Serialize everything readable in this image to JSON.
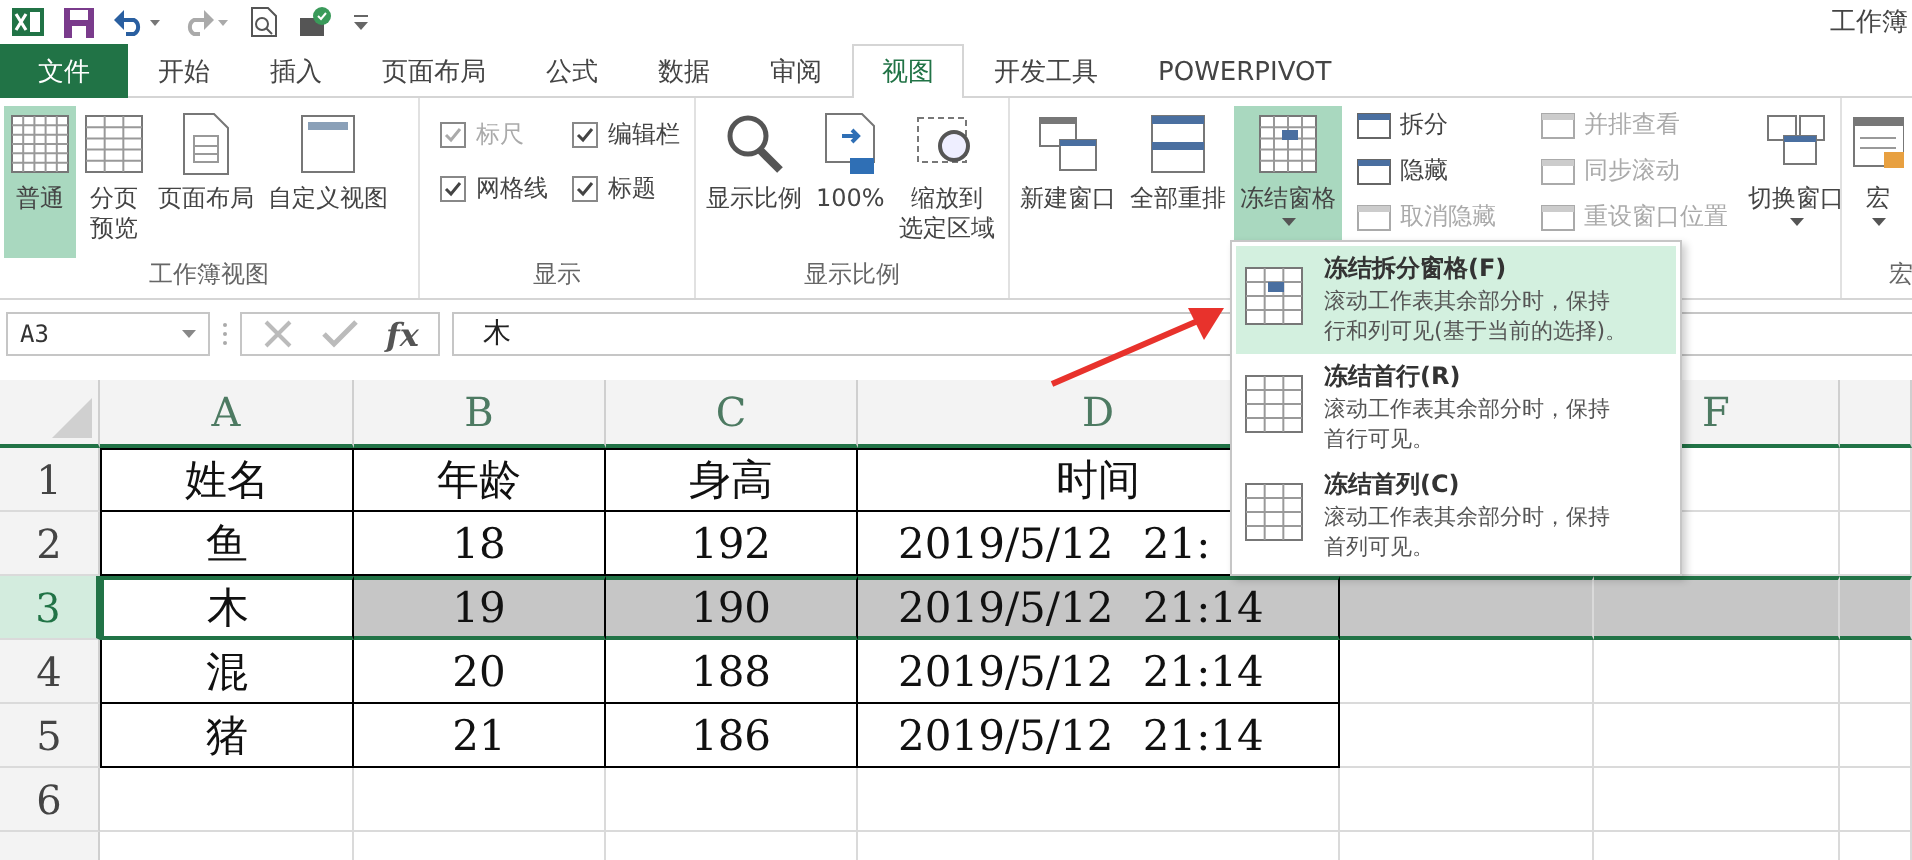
{
  "window": {
    "title": "工作簿"
  },
  "tabs": [
    {
      "label": "文件",
      "kind": "file",
      "selected": false
    },
    {
      "label": "开始",
      "kind": "tab",
      "selected": false
    },
    {
      "label": "插入",
      "kind": "tab",
      "selected": false
    },
    {
      "label": "页面布局",
      "kind": "tab",
      "selected": false
    },
    {
      "label": "公式",
      "kind": "tab",
      "selected": false
    },
    {
      "label": "数据",
      "kind": "tab",
      "selected": false
    },
    {
      "label": "审阅",
      "kind": "tab",
      "selected": false
    },
    {
      "label": "视图",
      "kind": "tab",
      "selected": true
    },
    {
      "label": "开发工具",
      "kind": "tab",
      "selected": false
    },
    {
      "label": "POWERPIVOT",
      "kind": "tab",
      "selected": false
    }
  ],
  "ribbon": {
    "groups": [
      {
        "label": "工作簿视图",
        "items": [
          {
            "kind": "large",
            "label_lines": [
              "普通"
            ],
            "selected": true,
            "dropdown": false
          },
          {
            "kind": "large",
            "label_lines": [
              "分页",
              "预览"
            ],
            "selected": false,
            "dropdown": false
          },
          {
            "kind": "large",
            "label_lines": [
              "页面布局"
            ],
            "selected": false,
            "dropdown": false
          },
          {
            "kind": "large",
            "label_lines": [
              "自定义视图"
            ],
            "selected": false,
            "dropdown": false
          }
        ]
      },
      {
        "label": "显示",
        "items": [
          {
            "kind": "checks",
            "checks": [
              {
                "label": "标尺",
                "checked": true,
                "disabled": true
              },
              {
                "label": "编辑栏",
                "checked": true,
                "disabled": false
              },
              {
                "label": "网格线",
                "checked": true,
                "disabled": false
              },
              {
                "label": "标题",
                "checked": true,
                "disabled": false
              }
            ]
          }
        ]
      },
      {
        "label": "显示比例",
        "items": [
          {
            "kind": "large",
            "label_lines": [
              "显示比例"
            ],
            "selected": false,
            "dropdown": false
          },
          {
            "kind": "large",
            "label_lines": [
              "100%"
            ],
            "selected": false,
            "dropdown": false
          },
          {
            "kind": "large",
            "label_lines": [
              "缩放到",
              "选定区域"
            ],
            "selected": false,
            "dropdown": false
          }
        ]
      },
      {
        "items": [
          {
            "kind": "large",
            "label_lines": [
              "新建窗口"
            ],
            "selected": false,
            "dropdown": false
          },
          {
            "kind": "large",
            "label_lines": [
              "全部重排"
            ],
            "selected": false,
            "dropdown": false
          },
          {
            "kind": "large",
            "label_lines": [
              "冻结窗格"
            ],
            "selected": true,
            "dropdown": true
          },
          {
            "kind": "smalls",
            "buttons": [
              {
                "label": "拆分",
                "disabled": false
              },
              {
                "label": "隐藏",
                "disabled": false
              },
              {
                "label": "取消隐藏",
                "disabled": true
              }
            ]
          },
          {
            "kind": "smalls",
            "buttons": [
              {
                "label": "并排查看",
                "disabled": true
              },
              {
                "label": "同步滚动",
                "disabled": true
              },
              {
                "label": "重设窗口位置",
                "disabled": true
              }
            ]
          },
          {
            "kind": "large",
            "label_lines": [
              "切换窗口"
            ],
            "selected": false,
            "dropdown": true
          }
        ]
      },
      {
        "label": "宏",
        "items": [
          {
            "kind": "large",
            "label_lines": [
              "宏"
            ],
            "selected": false,
            "dropdown": true
          }
        ]
      }
    ]
  },
  "formula_bar": {
    "name_box": "A3",
    "function_label": "fx",
    "value": "木"
  },
  "sheet": {
    "column_headers": [
      "A",
      "B",
      "C",
      "D",
      "F"
    ],
    "rows": [
      {
        "header": "1",
        "selected": false,
        "cells": [
          "姓名",
          "年龄",
          "身高",
          "时间"
        ]
      },
      {
        "header": "2",
        "selected": false,
        "cells": [
          "鱼",
          "18",
          "192",
          "2019/5/12 21:"
        ]
      },
      {
        "header": "3",
        "selected": true,
        "cells": [
          "木",
          "19",
          "190",
          "2019/5/12 21:14"
        ]
      },
      {
        "header": "4",
        "selected": false,
        "cells": [
          "混",
          "20",
          "188",
          "2019/5/12 21:14"
        ]
      },
      {
        "header": "5",
        "selected": false,
        "cells": [
          "猪",
          "21",
          "186",
          "2019/5/12 21:14"
        ]
      },
      {
        "header": "6",
        "selected": false,
        "cells": []
      }
    ]
  },
  "freeze_menu": {
    "items": [
      {
        "title": "冻结拆分窗格(F)",
        "description_lines": [
          "滚动工作表其余部分时，保持",
          "行和列可见(基于当前的选择)。"
        ],
        "selected": true
      },
      {
        "title": "冻结首行(R)",
        "description_lines": [
          "滚动工作表其余部分时，保持",
          "首行可见。"
        ],
        "selected": false
      },
      {
        "title": "冻结首列(C)",
        "description_lines": [
          "滚动工作表其余部分时，保持",
          "首列可见。"
        ],
        "selected": false
      }
    ]
  }
}
